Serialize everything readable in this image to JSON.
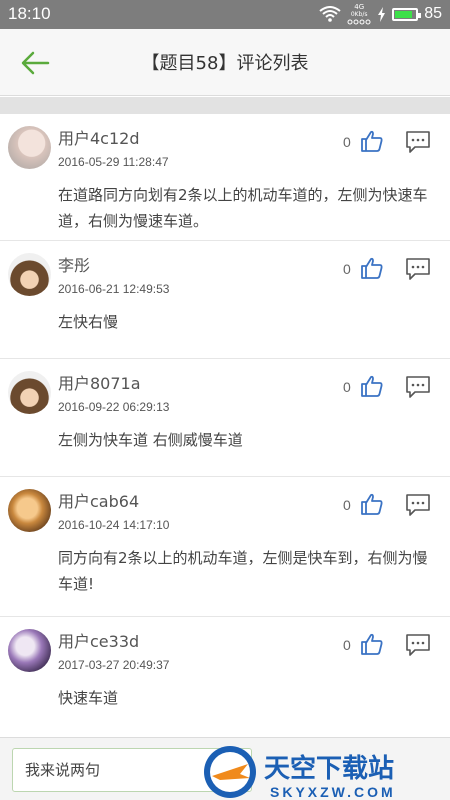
{
  "status": {
    "time": "18:10",
    "net_gen": "4G",
    "net_speed": "0Kb/s",
    "battery": "85",
    "battery_level": 0.85
  },
  "header": {
    "title": "【题目58】评论列表"
  },
  "comments": [
    {
      "user": "用户4c12d",
      "time": "2016-05-29 11:28:47",
      "likes": "0",
      "text": "在道路同方向划有2条以上的机动车道的，左侧为快速车道，右侧为慢速车道。"
    },
    {
      "user": "李彤",
      "time": "2016-06-21 12:49:53",
      "likes": "0",
      "text": "左快右慢"
    },
    {
      "user": "用户8071a",
      "time": "2016-09-22 06:29:13",
      "likes": "0",
      "text": "左侧为快车道 右侧威慢车道"
    },
    {
      "user": "用户cab64",
      "time": "2016-10-24 14:17:10",
      "likes": "0",
      "text": "同方向有2条以上的机动车道，左侧是快车到，右侧为慢车道!"
    },
    {
      "user": "用户ce33d",
      "time": "2017-03-27 20:49:37",
      "likes": "0",
      "text": "快速车道"
    }
  ],
  "input": {
    "placeholder": "我来说两句"
  },
  "watermark": {
    "brand": "天空下载站",
    "url": "SKYXZW.COM"
  },
  "colors": {
    "accent": "#5aaa3c",
    "icon": "#3b73c4"
  }
}
